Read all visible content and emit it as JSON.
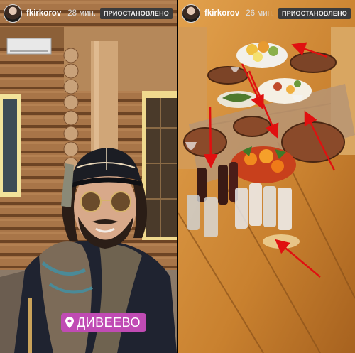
{
  "stories": [
    {
      "username": "fkirkorov",
      "time": "28 мин.",
      "status_label": "ПРИОСТАНОВЛЕНО",
      "location_sticker": "ДИВЕЕВО"
    },
    {
      "username": "fkirkorov",
      "time": "26 мин.",
      "status_label": "ПРИОСТАНОВЛЕНО"
    }
  ],
  "colors": {
    "sticker": "#c04bb4",
    "arrows": "#e01010"
  },
  "icons": [
    "avatar",
    "location-pin-icon"
  ]
}
